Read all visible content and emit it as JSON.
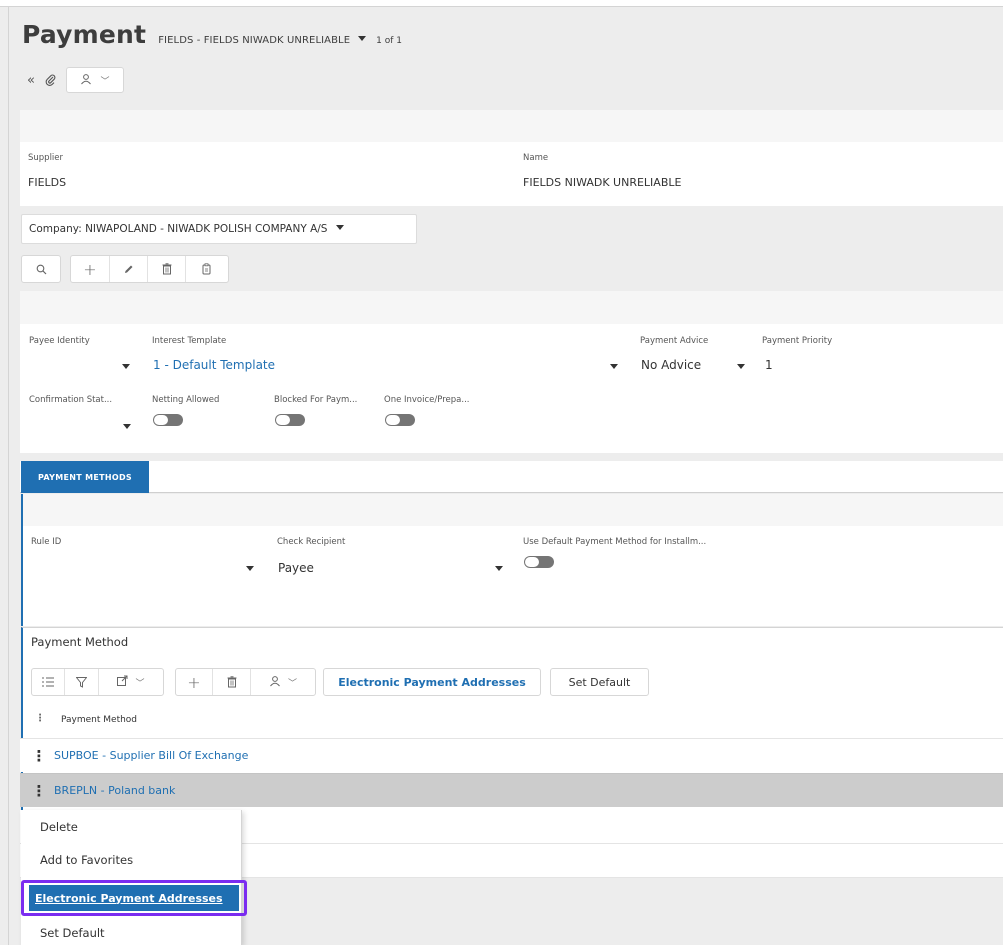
{
  "header": {
    "title": "Payment",
    "subtitle": "FIELDS - FIELDS NIWADK UNRELIABLE",
    "page_count": "1 of 1"
  },
  "sub_toolbar": {
    "icons": [
      "collapse-double-chevron-icon",
      "paperclip-icon",
      "person-assign-icon",
      "chevron-down-icon"
    ]
  },
  "supplier_card": {
    "supplier_label": "Supplier",
    "supplier_value": "FIELDS",
    "name_label": "Name",
    "name_value": "FIELDS NIWADK UNRELIABLE"
  },
  "company_selector": "Company: NIWAPOLAND - NIWADK POLISH COMPANY A/S",
  "record_toolbar": {
    "icons": [
      "search-icon",
      "plus-icon",
      "pencil-icon",
      "trash-icon",
      "copy-icon"
    ]
  },
  "details": {
    "payee_identity_label": "Payee Identity",
    "interest_template_label": "Interest Template",
    "interest_template_value": "1 - Default Template",
    "payment_advice_label": "Payment Advice",
    "payment_advice_value": "No Advice",
    "payment_priority_label": "Payment Priority",
    "payment_priority_value": "1",
    "confirmation_status_label": "Confirmation Stat...",
    "netting_allowed_label": "Netting Allowed",
    "blocked_for_payment_label": "Blocked For Paym...",
    "one_invoice_label": "One Invoice/Prepa..."
  },
  "tabs": [
    {
      "label": "PAYMENT METHODS",
      "active": true
    }
  ],
  "payment_methods_card": {
    "rule_id_label": "Rule ID",
    "check_recipient_label": "Check Recipient",
    "check_recipient_value": "Payee",
    "use_default_label": "Use Default Payment Method for Installm..."
  },
  "payment_method_section": {
    "title": "Payment Method",
    "electronic_addresses_button": "Electronic Payment Addresses",
    "set_default_button": "Set Default",
    "column_header": "Payment Method",
    "rows": [
      {
        "text": "SUPBOE - Supplier Bill Of Exchange",
        "selected": false
      },
      {
        "text": "BREPLN - Poland bank",
        "selected": true
      }
    ]
  },
  "context_menu": {
    "items": [
      "Delete",
      "Add to Favorites",
      "Electronic Payment Addresses",
      "Set Default"
    ],
    "highlighted": "Electronic Payment Addresses"
  },
  "colors": {
    "accent": "#1f6fb2",
    "highlight_border": "#7b2cf0",
    "selected_row": "#cccccc",
    "toggle_off": "#757575"
  }
}
